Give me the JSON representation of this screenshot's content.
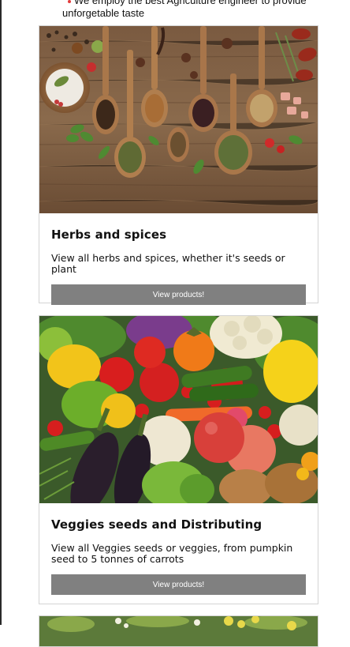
{
  "intro": {
    "line1": "We employ the best Agriculture engineer to provide",
    "line2": "unforgetable taste"
  },
  "cards": [
    {
      "title": "Herbs and spices",
      "description": "View all herbs and spices, whether it's seeds or plant",
      "button_label": "View products!",
      "image_alt": "herbs-and-spices-photo"
    },
    {
      "title": "Veggies seeds and Distributing",
      "description": "View all Veggies seeds or veggies, from pumpkin seed to 5 tonnes of carrots",
      "button_label": "View products!",
      "image_alt": "vegetables-photo"
    },
    {
      "image_alt": "flowers-photo"
    }
  ],
  "colors": {
    "button": "#808080",
    "card_border": "#d4d4d4",
    "bullet": "#e23c3c"
  }
}
